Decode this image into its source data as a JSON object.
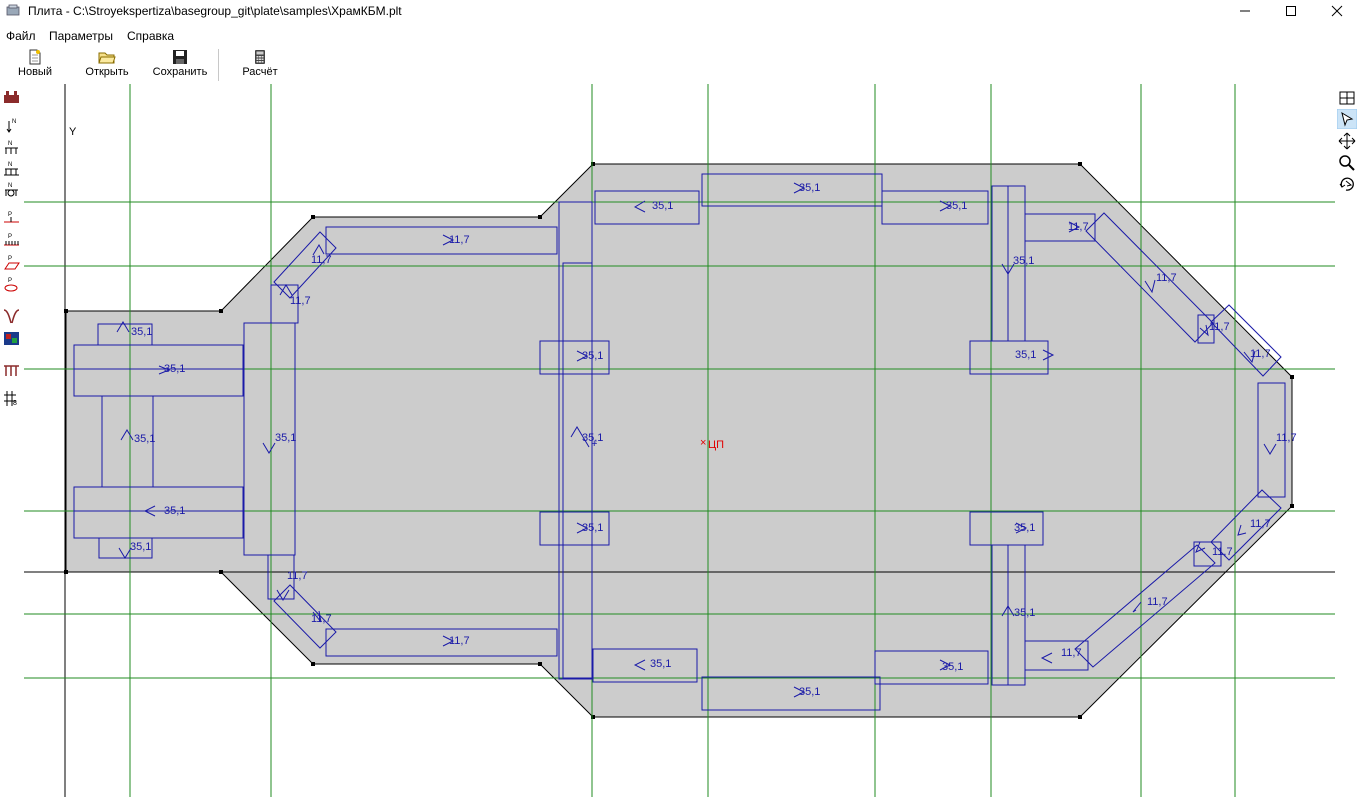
{
  "window": {
    "title": "Плита - C:\\Stroyekspertiza\\basegroup_git\\plate\\samples\\ХрамКБМ.plt",
    "minimize_symbol": "—",
    "maximize_symbol": "☐",
    "close_symbol": "✕"
  },
  "menu": {
    "file": "Файл",
    "params": "Параметры",
    "help": "Справка"
  },
  "toolbar": {
    "new": "Новый",
    "open": "Открыть",
    "save": "Сохранить",
    "calc": "Расчёт"
  },
  "canvas": {
    "axis_y_label": "Y",
    "center_label": "ЦП",
    "center_mark": "×",
    "load_labels": {
      "a": "35,1",
      "b": "11,7",
      "c": "+"
    },
    "colors": {
      "plate_fill": "#cccccc",
      "grid_green": "#228b22",
      "elements_blue": "#1a1aa8",
      "center_red": "#e00000"
    }
  },
  "icons": {
    "left": [
      "plate-icon",
      "force-n-icon",
      "force-n-group-icon",
      "force-n-group2-icon",
      "force-n-group3-icon",
      "force-p-line-icon",
      "force-p-line2-icon",
      "force-p-area-icon",
      "force-p-circle-icon",
      "spring-icon",
      "colormap-icon",
      "supports-icon",
      "grid-icon"
    ],
    "right": [
      "grid-toggle-icon",
      "pointer-icon",
      "move-icon",
      "zoom-icon",
      "rotate-icon"
    ]
  }
}
